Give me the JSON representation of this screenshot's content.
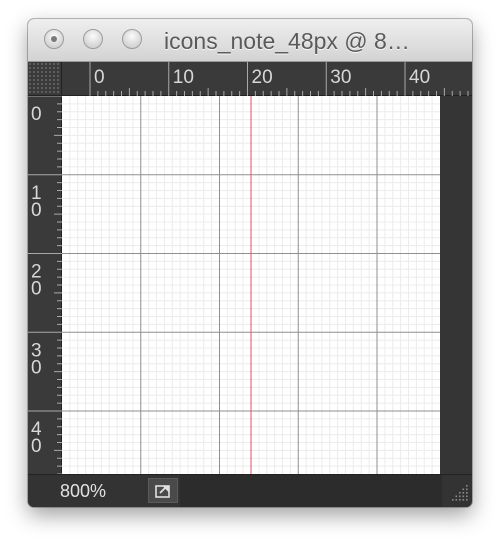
{
  "window": {
    "title": "icons_note_48px @ 8…"
  },
  "rulers": {
    "horizontal_labels": [
      "0",
      "10",
      "20",
      "30",
      "40"
    ],
    "vertical_labels": [
      [
        "0"
      ],
      [
        "1",
        "0"
      ],
      [
        "2",
        "0"
      ],
      [
        "3",
        "0"
      ],
      [
        "4",
        "0"
      ]
    ]
  },
  "canvas": {
    "guide_color": "#e0506a"
  },
  "status": {
    "zoom": "800%"
  },
  "icons": {
    "export": "share-arrow-icon",
    "resize": "resize-grip-icon"
  }
}
